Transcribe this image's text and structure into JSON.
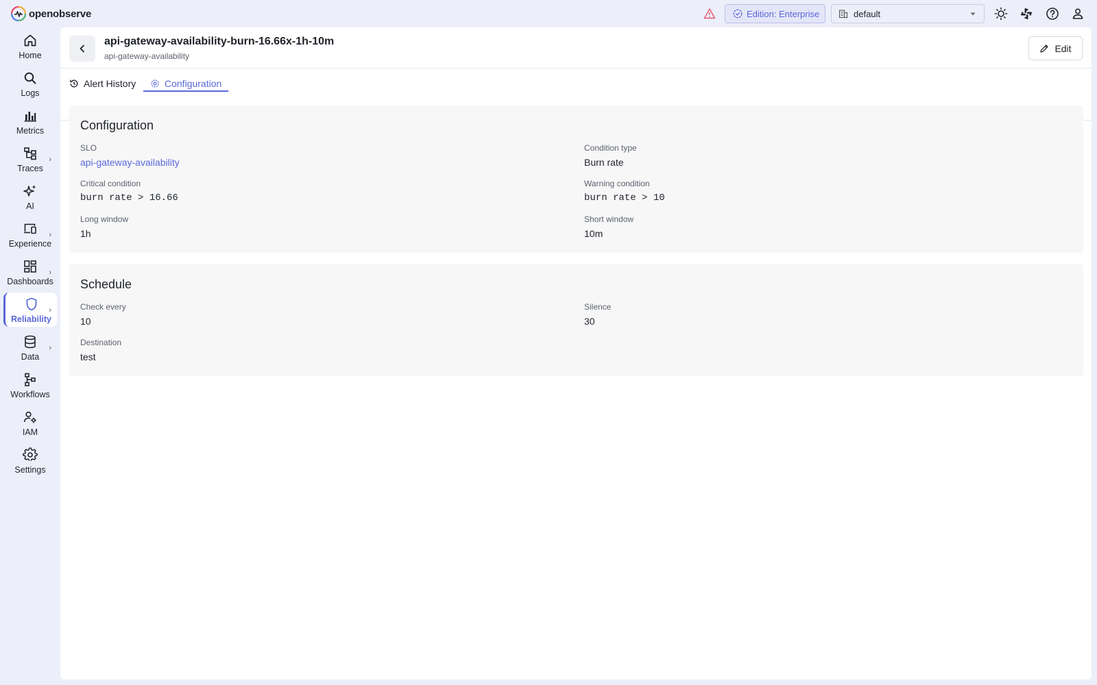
{
  "app": {
    "logo_text": "openobserve",
    "edition_label": "Edition: Enterprise",
    "org_selected": "default",
    "accent_color": "#5a67d8"
  },
  "sidebar": {
    "items": [
      {
        "label": "Home",
        "icon": "home-icon"
      },
      {
        "label": "Logs",
        "icon": "search-icon"
      },
      {
        "label": "Metrics",
        "icon": "bar-chart-icon"
      },
      {
        "label": "Traces",
        "icon": "traces-icon"
      },
      {
        "label": "AI",
        "icon": "sparkle-icon"
      },
      {
        "label": "Experience",
        "icon": "devices-icon"
      },
      {
        "label": "Dashboards",
        "icon": "dashboard-icon"
      },
      {
        "label": "Reliability",
        "icon": "shield-icon"
      },
      {
        "label": "Data",
        "icon": "database-icon"
      },
      {
        "label": "Workflows",
        "icon": "workflow-icon"
      },
      {
        "label": "IAM",
        "icon": "user-gear-icon"
      },
      {
        "label": "Settings",
        "icon": "gear-icon"
      }
    ],
    "active": "Reliability"
  },
  "header": {
    "title": "api-gateway-availability-burn-16.66x-1h-10m",
    "subtitle": "api-gateway-availability",
    "edit_label": "Edit"
  },
  "tabs": [
    {
      "label": "Alert History",
      "icon": "history-icon"
    },
    {
      "label": "Configuration",
      "icon": "gear-icon"
    }
  ],
  "active_tab": "Configuration",
  "configuration": {
    "title": "Configuration",
    "fields": {
      "slo": {
        "label": "SLO",
        "value": "api-gateway-availability"
      },
      "condition_type": {
        "label": "Condition type",
        "value": "Burn rate"
      },
      "critical_condition": {
        "label": "Critical condition",
        "value": "burn rate > 16.66"
      },
      "warning_condition": {
        "label": "Warning condition",
        "value": "burn rate > 10"
      },
      "long_window": {
        "label": "Long window",
        "value": "1h"
      },
      "short_window": {
        "label": "Short window",
        "value": "10m"
      }
    }
  },
  "schedule": {
    "title": "Schedule",
    "fields": {
      "check_every": {
        "label": "Check every",
        "value": "10"
      },
      "silence": {
        "label": "Silence",
        "value": "30"
      },
      "destination": {
        "label": "Destination",
        "value": "test"
      }
    }
  }
}
